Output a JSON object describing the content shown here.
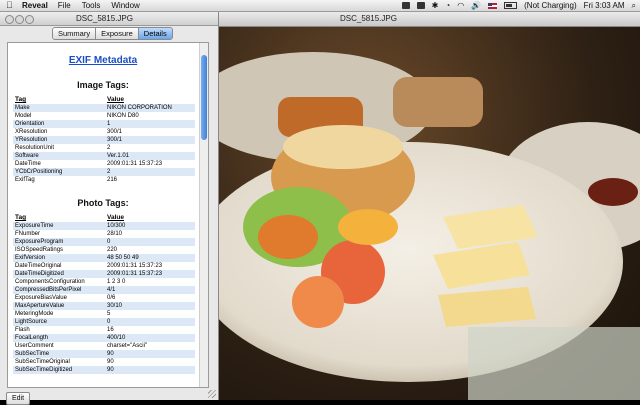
{
  "menubar": {
    "app_name": "Reveal",
    "menus": [
      "File",
      "Tools",
      "Window"
    ],
    "status": "(Not Charging)",
    "clock": "Fri 3:03 AM"
  },
  "photo_window": {
    "title": "DSC_5815.JPG"
  },
  "exif_window": {
    "title": "DSC_5815.JPG",
    "tabs": [
      "Summary",
      "Exposure",
      "Details"
    ],
    "active_tab": "Details",
    "heading": "EXIF Metadata",
    "image_tags": {
      "title": "Image Tags:",
      "col_tag": "Tag",
      "col_value": "Value",
      "rows": [
        [
          "Make",
          "NIKON CORPORATION"
        ],
        [
          "Model",
          "NIKON D80"
        ],
        [
          "Orientation",
          "1"
        ],
        [
          "XResolution",
          "300/1"
        ],
        [
          "YResolution",
          "300/1"
        ],
        [
          "ResolutionUnit",
          "2"
        ],
        [
          "Software",
          "Ver.1.01"
        ],
        [
          "DateTime",
          "2009:01:31 15:37:23"
        ],
        [
          "YCbCrPositioning",
          "2"
        ],
        [
          "ExifTag",
          "216"
        ]
      ]
    },
    "photo_tags": {
      "title": "Photo Tags:",
      "col_tag": "Tag",
      "col_value": "Value",
      "rows": [
        [
          "ExposureTime",
          "10/300"
        ],
        [
          "FNumber",
          "28/10"
        ],
        [
          "ExposureProgram",
          "0"
        ],
        [
          "ISOSpeedRatings",
          "220"
        ],
        [
          "ExifVersion",
          "48 50 50 49"
        ],
        [
          "DateTimeOriginal",
          "2009:01:31 15:37:23"
        ],
        [
          "DateTimeDigitized",
          "2009:01:31 15:37:23"
        ],
        [
          "ComponentsConfiguration",
          "1 2 3 0"
        ],
        [
          "CompressedBitsPerPixel",
          "4/1"
        ],
        [
          "ExposureBiasValue",
          "0/6"
        ],
        [
          "MaxApertureValue",
          "30/10"
        ],
        [
          "MeteringMode",
          "5"
        ],
        [
          "LightSource",
          "0"
        ],
        [
          "Flash",
          "16"
        ],
        [
          "FocalLength",
          "400/10"
        ],
        [
          "UserComment",
          "charset=\"Ascii\""
        ],
        [
          "SubSecTime",
          "90"
        ],
        [
          "SubSecTimeOriginal",
          "90"
        ],
        [
          "SubSecTimeDigitized",
          "90"
        ]
      ]
    },
    "edit_button": "Edit"
  }
}
